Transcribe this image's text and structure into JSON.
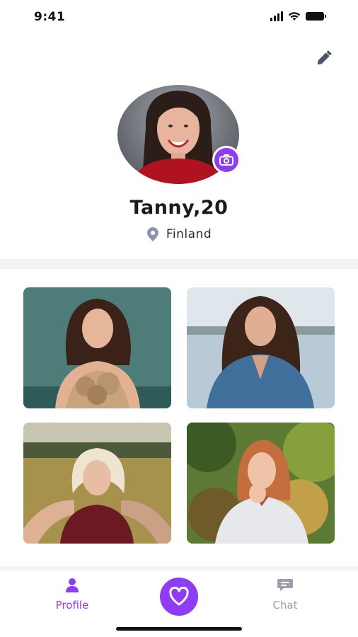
{
  "status": {
    "time": "9:41"
  },
  "profile": {
    "name": "Tanny,20",
    "location": "Finland",
    "accent_color": "#8E3DF4"
  },
  "icons": {
    "edit": "pencil-icon",
    "camera": "camera-icon",
    "location": "location-pin-icon",
    "profile_tab": "person-icon",
    "center": "heart-icon",
    "chat_tab": "chat-bubble-icon"
  },
  "gallery": {
    "photo_count": 4
  },
  "tabs": {
    "profile_label": "Profile",
    "chat_label": "Chat"
  }
}
